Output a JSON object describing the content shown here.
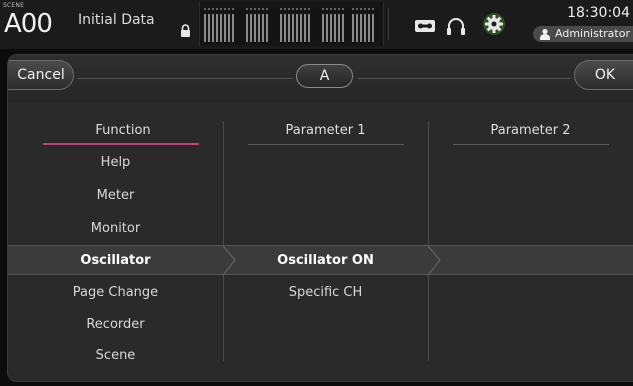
{
  "statusbar": {
    "scene_label": "SCENE",
    "scene_number": "A00",
    "scene_title": "Initial Data",
    "time": "18:30:04",
    "user": "Administrator"
  },
  "dialog": {
    "cancel_label": "Cancel",
    "ok_label": "OK",
    "bank_label": "A",
    "columns": {
      "function_header": "Function",
      "param1_header": "Parameter 1",
      "param2_header": "Parameter 2"
    },
    "function_items": [
      "Help",
      "Meter",
      "Monitor",
      "Oscillator",
      "Page Change",
      "Recorder",
      "Scene"
    ],
    "selected_function": "Oscillator",
    "param1_items": [
      "Oscillator ON",
      "Specific CH"
    ],
    "selected_param1": "Oscillator ON"
  },
  "colors": {
    "accent_underline": "#c2407a",
    "selection_row": "#3b3b3b",
    "background": "#2a2a2a"
  },
  "icons": [
    "lock-icon",
    "meter-bridge",
    "recorder-icon",
    "headphones-icon",
    "gear-icon",
    "user-icon"
  ]
}
